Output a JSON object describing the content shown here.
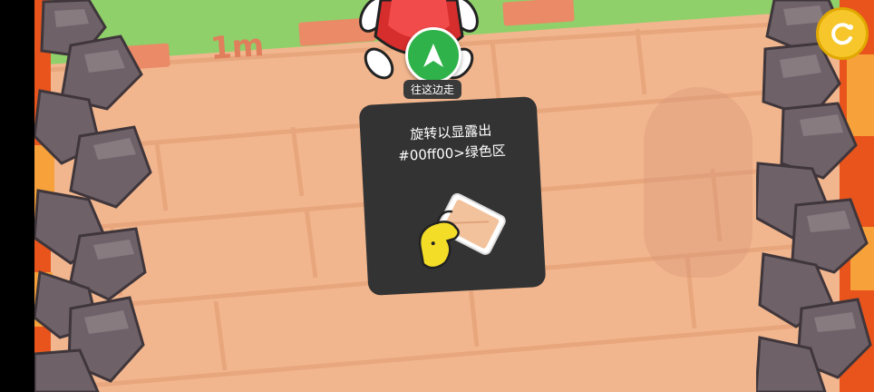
{
  "game": {
    "distance_marker": "1m",
    "direction_hint": "往这边走",
    "tip": {
      "line1": "旋转以显露出",
      "line2": "#00ff00>绿色区"
    },
    "score_button_icon": "swirl-icon",
    "nav_icon": "arrow-up-icon"
  },
  "colors": {
    "ground": "#f2b68e",
    "grass": "#8fd06a",
    "lava": "#e8541c",
    "rock": "#6e6268",
    "nav_green": "#2fb24a",
    "score_yellow": "#f6c62a",
    "tip_bg": "#333333"
  }
}
